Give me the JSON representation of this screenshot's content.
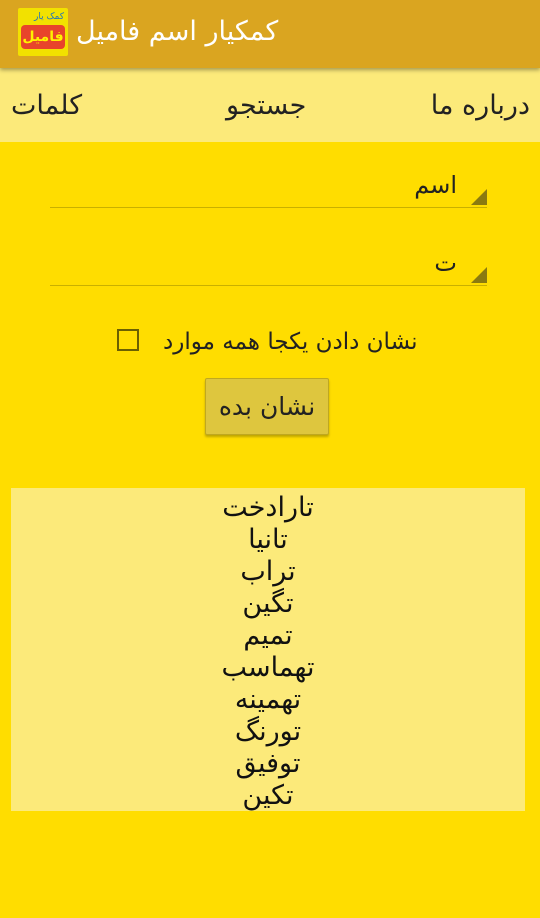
{
  "appbar": {
    "title": "کمکیار اسم فامیل",
    "logo_top_text": "کمک یار",
    "logo_main_text": "فامیل",
    "color": "#DAA520"
  },
  "tabs": {
    "words": "کلمات",
    "search": "جستجو",
    "about": "درباره ما"
  },
  "form": {
    "category_value": "اسم",
    "letter_value": "ت",
    "show_all_label": "نشان دادن یکجا همه موارد",
    "show_all_checked": false,
    "show_button_label": "نشان بده"
  },
  "results": [
    "تارادخت",
    "تانیا",
    "تراب",
    "تگین",
    "تمیم",
    "تهماسب",
    "تهمینه",
    "تورنگ",
    "توفیق",
    "تکین"
  ],
  "colors": {
    "background": "#FFDD00",
    "panel": "#FCEA7A",
    "button": "#DEC63E"
  }
}
